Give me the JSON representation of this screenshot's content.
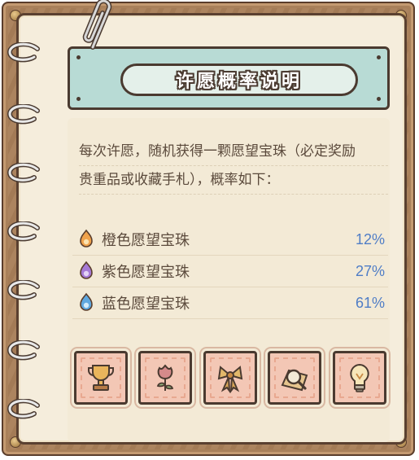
{
  "title": "许愿概率说明",
  "description": {
    "line1": "每次许愿，随机获得一颗愿望宝珠（必定奖励",
    "line2": "贵重品或收藏手札），概率如下："
  },
  "orbs": [
    {
      "label": "橙色愿望宝珠",
      "value": "12%",
      "icon": "orange-orb-icon",
      "color": "#f0a24b"
    },
    {
      "label": "紫色愿望宝珠",
      "value": "27%",
      "icon": "purple-orb-icon",
      "color": "#a67ad6"
    },
    {
      "label": "蓝色愿望宝珠",
      "value": "61%",
      "icon": "blue-orb-icon",
      "color": "#5fa8e0"
    }
  ],
  "reward_icons": [
    "trophy-icon",
    "rose-icon",
    "bow-icon",
    "magnifier-icon",
    "lightbulb-icon"
  ],
  "colors": {
    "banner": "#b8dbd5",
    "paper": "#f5eddc",
    "percent_text": "#4f7dc6",
    "stamp": "#f3c7b5"
  }
}
